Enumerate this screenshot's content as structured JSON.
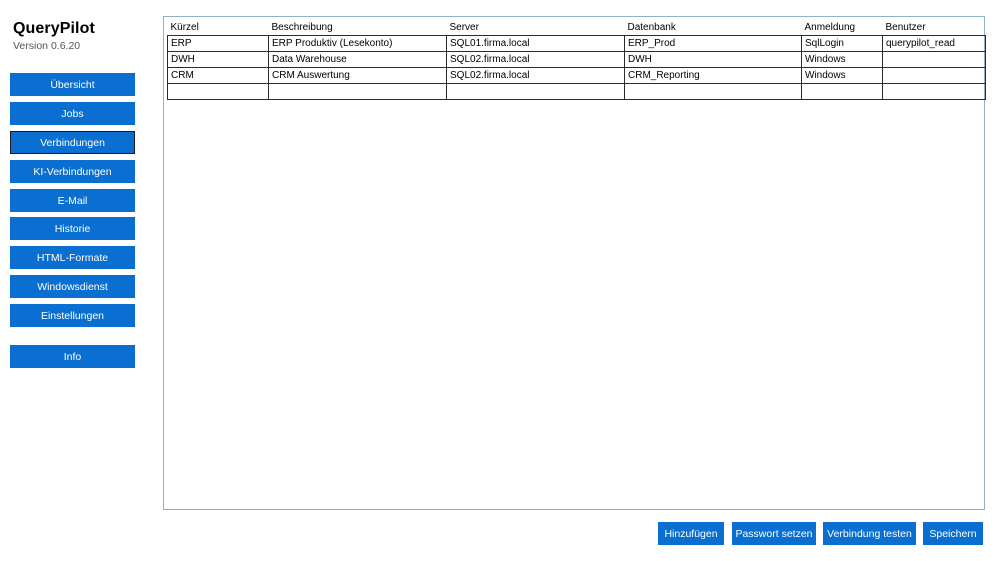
{
  "app": {
    "title": "QueryPilot",
    "version": "Version 0.6.20"
  },
  "nav": {
    "items": [
      {
        "label": "Übersicht"
      },
      {
        "label": "Jobs"
      },
      {
        "label": "Verbindungen"
      },
      {
        "label": "KI-Verbindungen"
      },
      {
        "label": "E-Mail"
      },
      {
        "label": "Historie"
      },
      {
        "label": "HTML-Formate"
      },
      {
        "label": "Windowsdienst"
      },
      {
        "label": "Einstellungen"
      },
      {
        "label": "Info"
      }
    ],
    "active": "Verbindungen"
  },
  "table": {
    "headers": [
      "Kürzel",
      "Beschreibung",
      "Server",
      "Datenbank",
      "Anmeldung",
      "Benutzer"
    ],
    "rows": [
      [
        "ERP",
        "ERP Produktiv (Lesekonto)",
        "SQL01.firma.local",
        "ERP_Prod",
        "SqlLogin",
        "querypilot_read"
      ],
      [
        "DWH",
        "Data Warehouse",
        "SQL02.firma.local",
        "DWH",
        "Windows",
        ""
      ],
      [
        "CRM",
        "CRM Auswertung",
        "SQL02.firma.local",
        "CRM_Reporting",
        "Windows",
        ""
      ],
      [
        "",
        "",
        "",
        "",
        "",
        ""
      ]
    ]
  },
  "actions": {
    "add": "Hinzufügen",
    "set_password": "Passwort setzen",
    "test_connection": "Verbindung testen",
    "save": "Speichern"
  },
  "colors": {
    "accent": "#0a6fd0",
    "panel_border": "#8fb3c9"
  }
}
